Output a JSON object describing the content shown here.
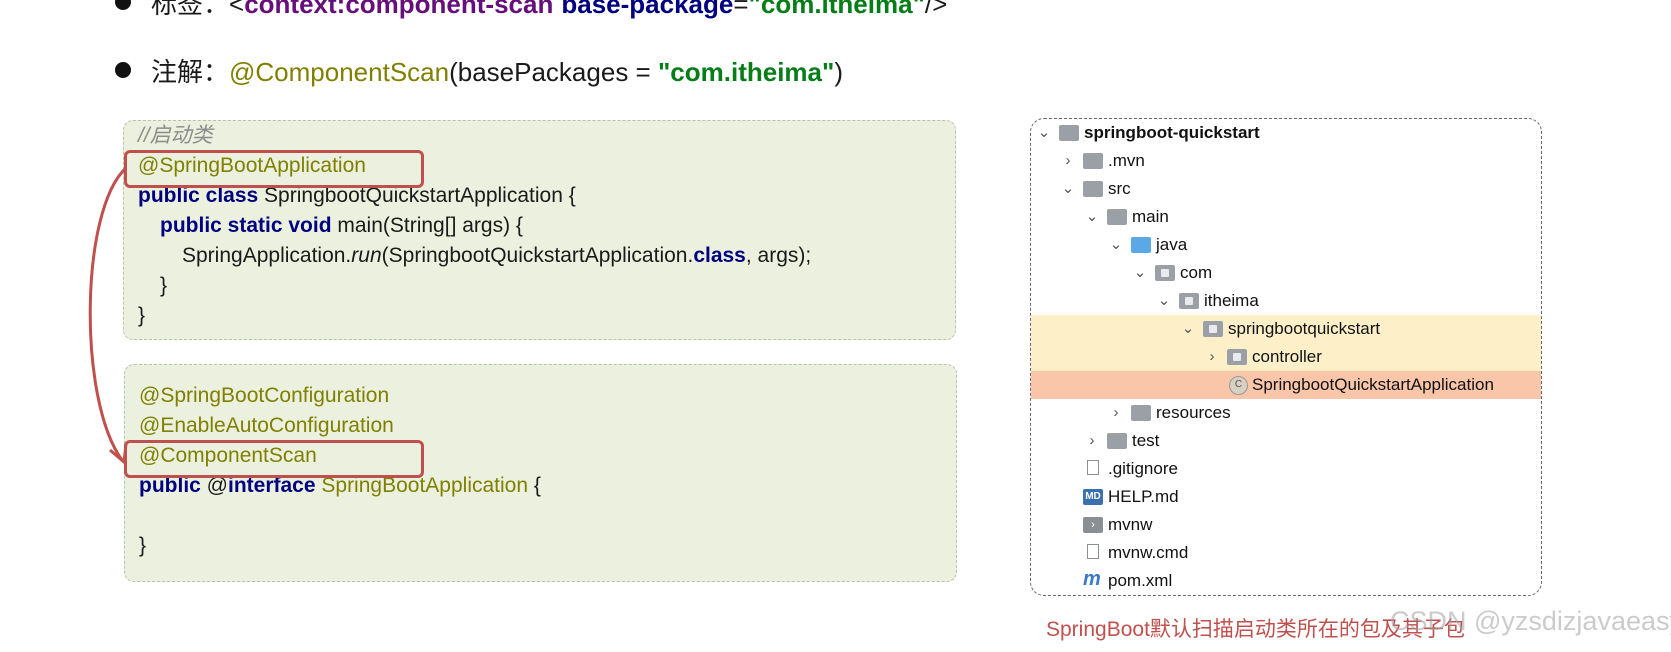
{
  "top_cut_line": {
    "label": "标签：",
    "open": "<",
    "tag": "context:component-scan",
    "attr": "base-package",
    "eq": "=",
    "value": "\"com.itheima\"",
    "close": "/>"
  },
  "annotation_line": {
    "label": "注解：",
    "annotation": "@ComponentScan",
    "args_open": "(basePackages = ",
    "value": "\"com.itheima\"",
    "args_close": ")"
  },
  "code_box_1": {
    "comment": "//启动类",
    "annotation": "@SpringBootApplication",
    "l2_kw": "public class",
    "l2_rest": " SpringbootQuickstartApplication {",
    "l3_kw": "public static void",
    "l3_rest": " main(String[] args) {",
    "l4_a": "SpringApplication.",
    "l4_run": "run",
    "l4_b": "(SpringbootQuickstartApplication.",
    "l4_class": "class",
    "l4_c": ", args);",
    "l5": "}",
    "l6": "}"
  },
  "code_box_2": {
    "a1": "@SpringBootConfiguration",
    "a2": "@EnableAutoConfiguration",
    "a3": "@ComponentScan",
    "l4_kw": "public",
    "l4_at": " @",
    "l4_interface": "interface",
    "l4_name": " SpringBootApplication",
    "l4_brace": " {",
    "l5": "}"
  },
  "project_tree": [
    {
      "label": "springboot-quickstart",
      "icon": "module-folder-icon",
      "expanded": true
    },
    {
      "label": ".mvn",
      "icon": "folder-icon",
      "expanded": false
    },
    {
      "label": "src",
      "icon": "folder-icon",
      "expanded": true
    },
    {
      "label": "main",
      "icon": "folder-icon",
      "expanded": true
    },
    {
      "label": "java",
      "icon": "source-folder-icon",
      "expanded": true
    },
    {
      "label": "com",
      "icon": "package-icon",
      "expanded": true
    },
    {
      "label": "itheima",
      "icon": "package-icon",
      "expanded": true
    },
    {
      "label": "springbootquickstart",
      "icon": "package-icon",
      "expanded": true,
      "highlight": "light"
    },
    {
      "label": "controller",
      "icon": "package-icon",
      "expanded": false
    },
    {
      "label": "SpringbootQuickstartApplication",
      "icon": "spring-class-icon",
      "highlight": "selected"
    },
    {
      "label": "resources",
      "icon": "resources-folder-icon",
      "expanded": false
    },
    {
      "label": "test",
      "icon": "folder-icon",
      "expanded": false
    },
    {
      "label": ".gitignore",
      "icon": "gitignore-icon"
    },
    {
      "label": "HELP.md",
      "icon": "markdown-icon"
    },
    {
      "label": "mvnw",
      "icon": "shell-script-icon"
    },
    {
      "label": "mvnw.cmd",
      "icon": "text-file-icon"
    },
    {
      "label": "pom.xml",
      "icon": "maven-icon"
    }
  ],
  "caption": "SpringBoot默认扫描启动类所在的包及其子包",
  "watermark": "CSDN @yzsdizjavaeasy",
  "colors": {
    "keyword": "#000080",
    "annotation": "#808000",
    "string": "#067d17",
    "highlight_border": "#c0504d",
    "code_bg": "#ebf1de",
    "row_selected": "#f9c6a9",
    "row_light": "#fdf0c8"
  }
}
